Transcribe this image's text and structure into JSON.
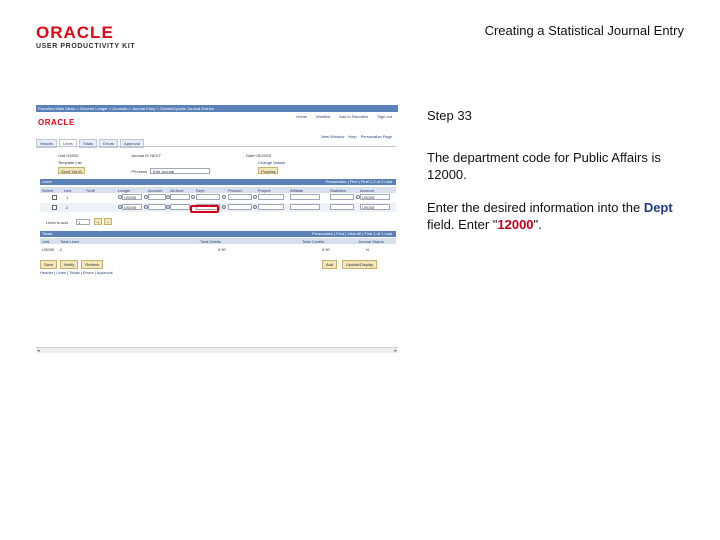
{
  "brand": {
    "name": "ORACLE",
    "tagline": "USER PRODUCTIVITY KIT",
    "color": "#e30613"
  },
  "title": "Creating a Statistical Journal Entry",
  "instructions": {
    "step": "Step 33",
    "description": "The department code for Public Affairs is 12000.",
    "action_prefix": "Enter the desired information into the",
    "field": "Dept",
    "action_mid": "field. Enter \"",
    "value": "12000",
    "action_suffix": "\"."
  },
  "screenshot": {
    "breadcrumb": "Favorites  Main Menu  > General Ledger > Journals > Journal Entry > Create/Update Journal Entries",
    "logo": "ORACLE",
    "header_links": [
      "Home",
      "Worklist",
      "Add to Favorites",
      "Sign out"
    ],
    "header_links2": [
      "New Window",
      "Help",
      "Personalize Page"
    ],
    "tabs": [
      "Header",
      "Lines",
      "Totals",
      "Errors",
      "Approval"
    ],
    "unit_label": "Unit  US005",
    "journal_label": "Journal ID  NEXT",
    "date_label": "Date  05/15/20",
    "template_label": "Template  List",
    "change_values": "Change Values",
    "send_btn": "Send Via M",
    "process_label": "*Process",
    "process_value": "Edit Journal",
    "process_btn": "Process",
    "grid_title": "Lines",
    "grid_ctrl": "Personalize | Find | First 1-2 of 2 Last",
    "columns": [
      "Select",
      "Line",
      "*Unit",
      "Ledger",
      "Account",
      "Alt Acct",
      "Dept",
      "Product",
      "Project",
      "Affiliate",
      "Statistics",
      "Amount"
    ],
    "rows": [
      {
        "line": "1",
        "unit": "US005",
        "account": "US005"
      },
      {
        "line": "2",
        "unit": "US005",
        "account": "US005"
      }
    ],
    "lines_to_add_label": "Lines to add",
    "lines_to_add_value": "1",
    "totals_title": "Totals",
    "totals_ctrl": "Personalize | Find | View All | First 1 of 1 Last",
    "totals_columns": [
      "Unit",
      "Total Lines",
      "Total Debits",
      "Total Credits",
      "Journal Status"
    ],
    "totals_row": [
      "US005",
      "2",
      "0.00",
      "0.00",
      "N"
    ],
    "buttons": {
      "save": "Save",
      "notify": "Notify",
      "refresh": "Refresh",
      "add": "Add",
      "update": "Update/Display"
    },
    "footer_links": "Header | Lines | Totals | Errors | Approval"
  }
}
